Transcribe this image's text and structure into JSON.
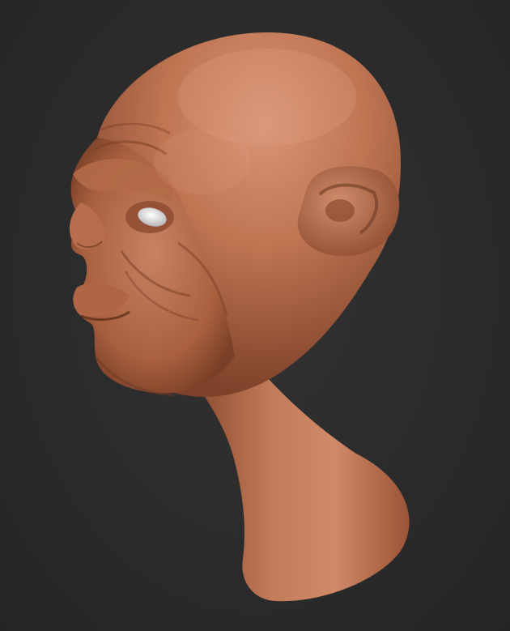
{
  "viewport": {
    "background_color": "#2a2a2b",
    "subject": "sculpted-head-render",
    "material_colors": {
      "skin_base": "#b8704e",
      "skin_highlight": "#d99575",
      "skin_shadow": "#6e3a24",
      "eye": "#e8e8ea"
    }
  }
}
